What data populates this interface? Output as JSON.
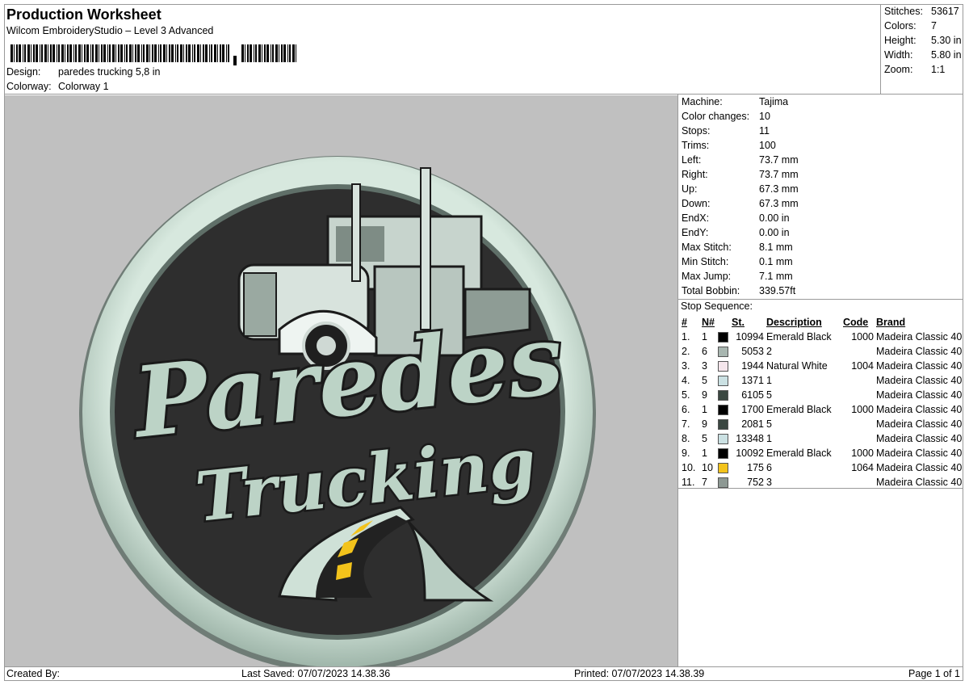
{
  "header": {
    "title": "Production Worksheet",
    "subtitle": "Wilcom EmbroideryStudio – Level 3 Advanced",
    "design_label": "Design:",
    "design_value": "paredes trucking 5,8 in",
    "colorway_label": "Colorway:",
    "colorway_value": "Colorway 1"
  },
  "summary": [
    {
      "label": "Stitches:",
      "value": "53617"
    },
    {
      "label": "Colors:",
      "value": "7"
    },
    {
      "label": "Height:",
      "value": "5.30 in"
    },
    {
      "label": "Width:",
      "value": "5.80 in"
    },
    {
      "label": "Zoom:",
      "value": "1:1"
    }
  ],
  "machine_info": [
    {
      "label": "Machine:",
      "value": "Tajima"
    },
    {
      "label": "Color changes:",
      "value": "10"
    },
    {
      "label": "Stops:",
      "value": "11"
    },
    {
      "label": "Trims:",
      "value": "100"
    },
    {
      "label": "Left:",
      "value": "73.7 mm"
    },
    {
      "label": "Right:",
      "value": "73.7 mm"
    },
    {
      "label": "Up:",
      "value": "67.3 mm"
    },
    {
      "label": "Down:",
      "value": "67.3 mm"
    },
    {
      "label": "EndX:",
      "value": "0.00 in"
    },
    {
      "label": "EndY:",
      "value": "0.00 in"
    },
    {
      "label": "Max Stitch:",
      "value": "8.1 mm"
    },
    {
      "label": "Min Stitch:",
      "value": "0.1 mm"
    },
    {
      "label": "Max Jump:",
      "value": "7.1 mm"
    },
    {
      "label": "Total Bobbin:",
      "value": "339.57ft"
    }
  ],
  "stop_sequence": {
    "title": "Stop Sequence:",
    "headers": {
      "num": "#",
      "n": "N#",
      "st": "St.",
      "desc": "Description",
      "code": "Code",
      "brand": "Brand"
    },
    "rows": [
      {
        "num": "1.",
        "n": "1",
        "color": "#000000",
        "st": "10994",
        "desc": "Emerald Black",
        "code": "1000",
        "brand": "Madeira Classic 40"
      },
      {
        "num": "2.",
        "n": "6",
        "color": "#a8b6b0",
        "st": "5053",
        "desc": "2",
        "code": "",
        "brand": "Madeira Classic 40"
      },
      {
        "num": "3.",
        "n": "3",
        "color": "#f5e6ec",
        "st": "1944",
        "desc": "Natural White",
        "code": "1004",
        "brand": "Madeira Classic 40"
      },
      {
        "num": "4.",
        "n": "5",
        "color": "#cbe1e3",
        "st": "1371",
        "desc": "1",
        "code": "",
        "brand": "Madeira Classic 40"
      },
      {
        "num": "5.",
        "n": "9",
        "color": "#3a4741",
        "st": "6105",
        "desc": "5",
        "code": "",
        "brand": "Madeira Classic 40"
      },
      {
        "num": "6.",
        "n": "1",
        "color": "#000000",
        "st": "1700",
        "desc": "Emerald Black",
        "code": "1000",
        "brand": "Madeira Classic 40"
      },
      {
        "num": "7.",
        "n": "9",
        "color": "#3a4741",
        "st": "2081",
        "desc": "5",
        "code": "",
        "brand": "Madeira Classic 40"
      },
      {
        "num": "8.",
        "n": "5",
        "color": "#cbe1e3",
        "st": "13348",
        "desc": "1",
        "code": "",
        "brand": "Madeira Classic 40"
      },
      {
        "num": "9.",
        "n": "1",
        "color": "#000000",
        "st": "10092",
        "desc": "Emerald Black",
        "code": "1000",
        "brand": "Madeira Classic 40"
      },
      {
        "num": "10.",
        "n": "10",
        "color": "#f3c31b",
        "st": "175",
        "desc": "6",
        "code": "1064",
        "brand": "Madeira Classic 40"
      },
      {
        "num": "11.",
        "n": "7",
        "color": "#8d9893",
        "st": "752",
        "desc": "3",
        "code": "",
        "brand": "Madeira Classic 40"
      }
    ]
  },
  "preview": {
    "logo_line1": "Paredes",
    "logo_line2": "Trucking",
    "background": "#c0c0c0",
    "thread_light": "#c5dbcf",
    "thread_dark": "#2b2b2b",
    "road_stripe": "#f3c31b"
  },
  "footer": {
    "created_by": "Created By:",
    "last_saved": "Last Saved: 07/07/2023 14.38.36",
    "printed": "Printed: 07/07/2023 14.38.39",
    "page": "Page 1 of 1"
  }
}
